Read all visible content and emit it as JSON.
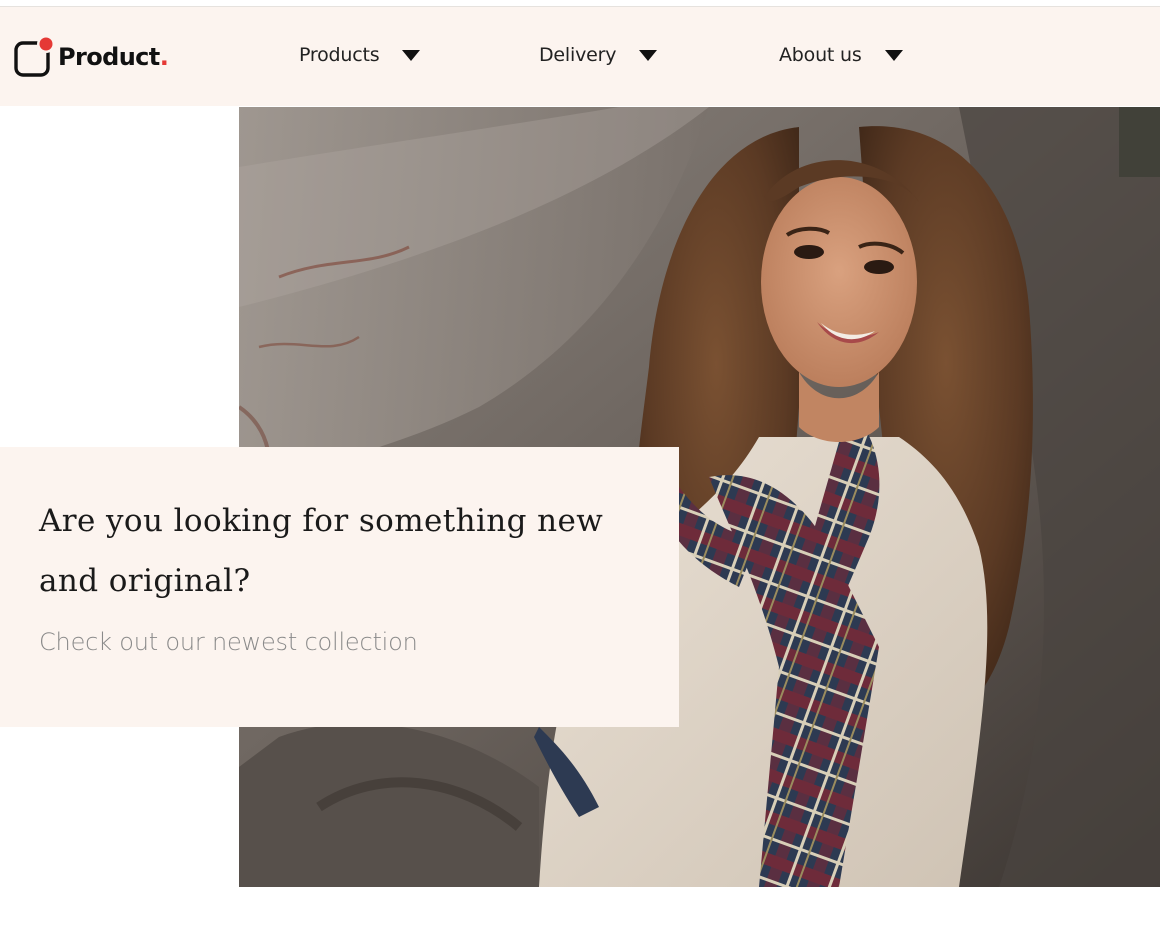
{
  "brand": {
    "name": "Product",
    "dot": ".",
    "logo_icon": "app-square-with-red-notification-dot",
    "accent_color": "#e53935"
  },
  "nav": {
    "items": [
      {
        "label": "Products",
        "icon": "caret-down-icon"
      },
      {
        "label": "Delivery",
        "icon": "caret-down-icon"
      },
      {
        "label": "About us",
        "icon": "caret-down-icon"
      }
    ]
  },
  "hero": {
    "image_alt": "Smiling woman with long wavy hair wearing a plaid scarf and beige coat in front of a large tree trunk",
    "headline": "Are you looking for something new and original?",
    "subtext": "Check out our newest collection"
  },
  "colors": {
    "header_bg": "#fcf4ef",
    "card_bg": "#fcf4ef",
    "text_dark": "#1a1a1a",
    "text_muted": "#8a8a8a"
  }
}
